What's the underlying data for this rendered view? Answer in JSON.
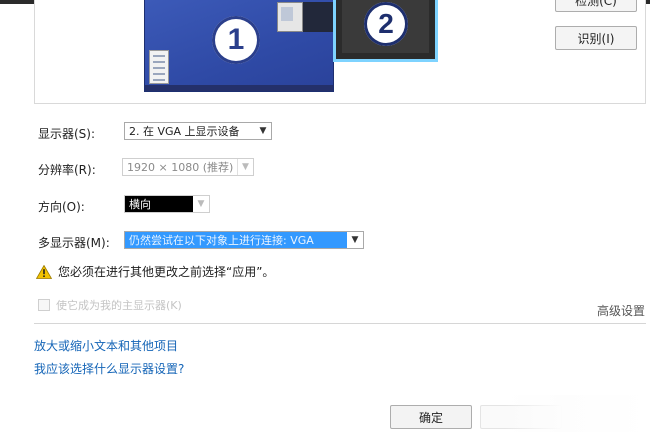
{
  "preview": {
    "monitor_1_number": "1",
    "monitor_2_number": "2",
    "detect_label": "检测(C)",
    "identify_label": "识别(I)"
  },
  "settings": {
    "display_label": "显示器(S):",
    "display_value": "2. 在 VGA 上显示设备",
    "resolution_label": "分辨率(R):",
    "resolution_value": "1920 × 1080 (推荐)",
    "orientation_label": "方向(O):",
    "orientation_value": "横向",
    "multi_display_label": "多显示器(M):",
    "multi_display_value": "仍然尝试在以下对象上进行连接: VGA"
  },
  "warning": {
    "icon": "warning-icon",
    "text": "您必须在进行其他更改之前选择“应用”。"
  },
  "primary_checkbox": {
    "label": "使它成为我的主显示器(K)",
    "checked": false
  },
  "advanced_link": "高级设置",
  "links": {
    "enlarge_text": "放大或缩小文本和其他项目",
    "which_settings": "我应该选择什么显示器设置?"
  },
  "footer": {
    "ok_label": "确定"
  },
  "colors": {
    "accent_selection": "#3399ff",
    "link": "#1565b7",
    "monitor_highlight": "#7ed3ff"
  }
}
